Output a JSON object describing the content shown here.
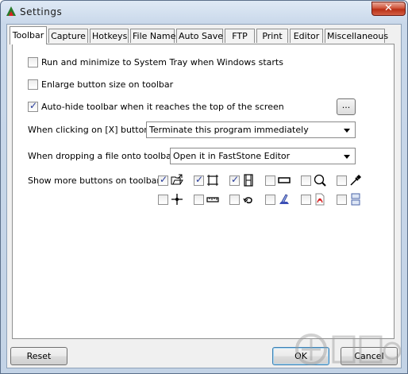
{
  "window": {
    "title": "Settings",
    "close_glyph": "✕"
  },
  "tabs": [
    {
      "label": "Toolbar",
      "active": true
    },
    {
      "label": "Capture"
    },
    {
      "label": "Hotkeys"
    },
    {
      "label": "File Name"
    },
    {
      "label": "Auto Save"
    },
    {
      "label": "FTP"
    },
    {
      "label": "Print"
    },
    {
      "label": "Editor"
    },
    {
      "label": "Miscellaneous"
    }
  ],
  "toolbar": {
    "options": [
      {
        "label": "Run and minimize to System Tray when Windows starts",
        "checked": false
      },
      {
        "label": "Enlarge button size on toolbar",
        "checked": false
      },
      {
        "label": "Auto-hide toolbar when it reaches the top of the screen",
        "checked": true
      }
    ],
    "more_button_label": "...",
    "close_action": {
      "label": "When clicking on [X] button :",
      "value": "Terminate this program immediately"
    },
    "drop_action": {
      "label": "When dropping a file onto toolbar :",
      "value": "Open it in FastStone Editor"
    },
    "show_buttons_label": "Show more buttons on toolbar :",
    "buttons": [
      {
        "icon": "open-file-icon",
        "checked": true
      },
      {
        "icon": "crop-rectangle-icon",
        "checked": true
      },
      {
        "icon": "film-icon",
        "checked": true
      },
      {
        "icon": "horizontal-bar-icon",
        "checked": false
      },
      {
        "icon": "magnifier-icon",
        "checked": false
      },
      {
        "icon": "color-picker-icon",
        "checked": false
      },
      {
        "icon": "crosshair-icon",
        "checked": false
      },
      {
        "icon": "ruler-icon",
        "checked": false
      },
      {
        "icon": "undo-curve-icon",
        "checked": false
      },
      {
        "icon": "draw-board-icon",
        "checked": false
      },
      {
        "icon": "pdf-icon",
        "checked": false
      },
      {
        "icon": "split-window-icon",
        "checked": false
      }
    ]
  },
  "footer": {
    "reset_label": "Reset",
    "ok_label": "OK",
    "cancel_label": "Cancel"
  },
  "colors": {
    "accent": "#3c7fb1",
    "check": "#263a9a",
    "close": "#c4402a"
  }
}
